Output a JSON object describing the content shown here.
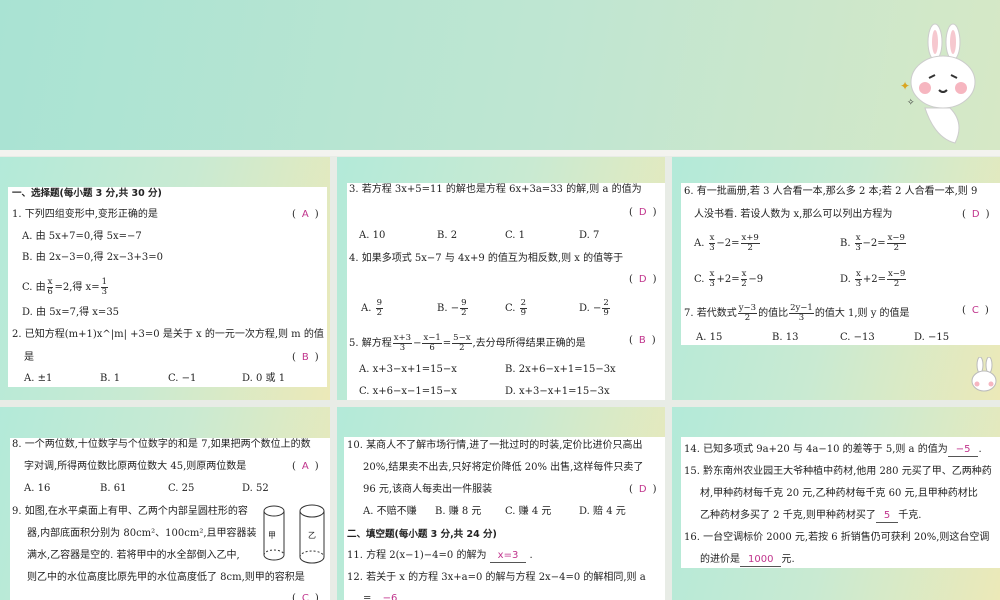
{
  "slide1": {
    "section": "一、选择题(每小题 3 分,共 30 分)",
    "q1": "1. 下列四组变形中,变形正确的是",
    "q1_answer": "A",
    "q1_options": [
      "A. 由 5x+7=0,得 5x=−7",
      "B. 由 2x−3=0,得 2x−3+3=0",
      "C. 由{x|6}=2,得 x={1|3}",
      "D. 由 5x=7,得 x=35"
    ],
    "q2": "2. 已知方程(m+1)x^|m| +3=0 是关于 x 的一元一次方程,则 m 的值",
    "q2_line2": "是",
    "q2_answer": "B",
    "q2_options": [
      "A. ±1",
      "B. 1",
      "C. −1",
      "D. 0 或 1"
    ]
  },
  "slide2": {
    "q3": "3. 若方程 3x+5=11 的解也是方程 6x+3a=33 的解,则 a 的值为",
    "q3_answer": "D",
    "q3_options": [
      "A. 10",
      "B. 2",
      "C. 1",
      "D. 7"
    ],
    "q4": "4. 如果多项式 5x−7 与 4x+9 的值互为相反数,则 x 的值等于",
    "q4_answer": "D",
    "q4_options": [
      "A. {9|2}",
      "B. −{9|2}",
      "C. {2|9}",
      "D. −{2|9}"
    ],
    "q5": "5. 解方程{x+3|3}−{x−1|6}={5−x|2},去分母所得结果正确的是",
    "q5_answer": "B",
    "q5_options": [
      "A. x+3−x+1=15−x",
      "B. 2x+6−x+1=15−3x",
      "C. x+6−x−1=15−x",
      "D. x+3−x+1=15−3x"
    ]
  },
  "slide3": {
    "q6": "6. 有一批画册,若 3 人合看一本,那么多 2 本;若 2 人合看一本,则 9",
    "q6_line2": "人没书看. 若设人数为 x,那么可以列出方程为",
    "q6_answer": "D",
    "q6_options": [
      "A. {x|3}−2={x+9|2}",
      "B. {x|3}−2={x−9|2}",
      "C. {x|3}+2={x|2}−9",
      "D. {x|3}+2={x−9|2}"
    ],
    "q7": "7. 若代数式{y−3|2}的值比{2y−1|3}的值大 1,则 y 的值是",
    "q7_answer": "C",
    "q7_options": [
      "A. 15",
      "B. 13",
      "C. −13",
      "D. −15"
    ]
  },
  "slide4": {
    "q8": "8. 一个两位数,十位数字与个位数字的和是 7,如果把两个数位上的数",
    "q8_line2": "字对调,所得两位数比原两位数大 45,则原两位数是",
    "q8_answer": "A",
    "q8_options": [
      "A. 16",
      "B. 61",
      "C. 25",
      "D. 52"
    ],
    "q9_lines": [
      "9. 如图,在水平桌面上有甲、乙两个内部呈圆柱形的容",
      "器,内部底面积分别为 80cm²、100cm²,且甲容器装",
      "满水,乙容器是空的. 若将甲中的水全部倒入乙中,",
      "则乙中的水位高度比原先甲的水位高度低了 8cm,则甲的容积是"
    ],
    "q9_answer": "C",
    "fig_labels": [
      "甲",
      "乙"
    ]
  },
  "slide5": {
    "q10_lines": [
      "10. 某商人不了解市场行情,进了一批过时的时装,定价比进价只高出",
      "20%,结果卖不出去,只好将定价降低 20% 出售,这样每件只卖了",
      "96 元,该商人每卖出一件服装"
    ],
    "q10_answer": "D",
    "q10_options": [
      "A. 不赔不赚",
      "B. 赚 8 元",
      "C. 赚 4 元",
      "D. 赔 4 元"
    ],
    "section": "二、填空题(每小题 3 分,共 24 分)",
    "q11": "11. 方程 2(x−1)−4=0 的解为",
    "q11_answer": "x=3",
    "q11_end": ".",
    "q12": "12. 若关于 x 的方程 3x+a=0 的解与方程 2x−4=0 的解相同,则 a",
    "q12_line2": "=",
    "q12_answer": "−6"
  },
  "slide6": {
    "q14": "14. 已知多项式 9a+20 与 4a−10 的差等于 5,则 a 的值为",
    "q14_answer": "−5",
    "q14_end": ".",
    "q15_lines": [
      "15. 黔东南州农业园王大爷种植中药材,他用 280 元买了甲、乙两种药",
      "材,甲种药材每千克 20 元,乙种药材每千克 60 元,且甲种药材比"
    ],
    "q15_line3": "乙种药材多买了 2 千克,则甲种药材买了",
    "q15_answer": "5",
    "q15_end": "千克.",
    "q16": "16. 一台空调标价 2000 元,若按 6 折销售仍可获利 20%,则这台空调",
    "q16_line2": "的进价是",
    "q16_answer": "1000",
    "q16_end": "元."
  },
  "paren_open": "(",
  "paren_close": ")"
}
